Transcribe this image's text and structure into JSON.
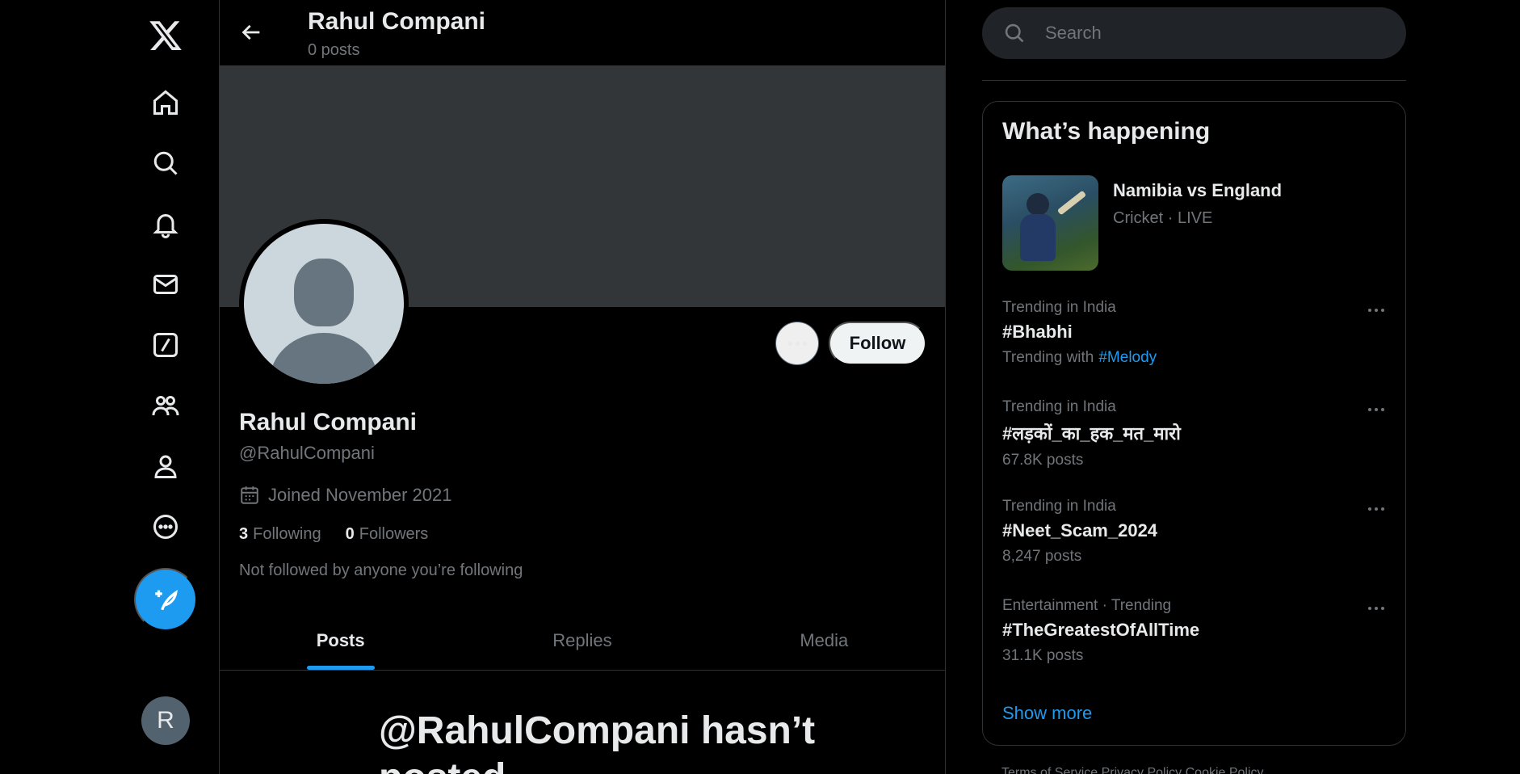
{
  "nav": {
    "items": [
      "home-icon",
      "explore-icon",
      "notifications-icon",
      "messages-icon",
      "grok-icon",
      "communities-icon",
      "profile-icon",
      "more-icon"
    ],
    "compose": "compose-post-icon",
    "account_initial": "R"
  },
  "header": {
    "name": "Rahul Compani",
    "post_count": "0 posts"
  },
  "profile": {
    "name": "Rahul Compani",
    "handle": "@RahulCompani",
    "joined": "Joined November 2021",
    "following_count": "3",
    "following_label": "Following",
    "followers_count": "0",
    "followers_label": "Followers",
    "not_followed_text": "Not followed by anyone you’re following",
    "follow_label": "Follow"
  },
  "tabs": [
    "Posts",
    "Replies",
    "Media"
  ],
  "empty": {
    "title": "@RahulCompani hasn’t posted"
  },
  "search": {
    "placeholder": "Search"
  },
  "trends": {
    "title": "What’s happening",
    "featured": {
      "title": "Namibia vs England",
      "subtitle": "Cricket · LIVE"
    },
    "items": [
      {
        "context": "Trending in India",
        "tag": "#Bhabhi",
        "meta": "Trending with",
        "link": "#Melody"
      },
      {
        "context": "Trending in India",
        "tag": "#लड़कों_का_हक_मत_मारो",
        "meta": "67.8K posts"
      },
      {
        "context": "Trending in India",
        "tag": "#Neet_Scam_2024",
        "meta": "8,247 posts"
      },
      {
        "context": "Entertainment · Trending",
        "tag": "#TheGreatestOfAllTime",
        "meta": "31.1K posts"
      }
    ],
    "show_more": "Show more"
  },
  "footer": {
    "text": "Terms of Service   Privacy Policy   Cookie Policy"
  },
  "colors": {
    "accent": "#1d9bf0",
    "background": "#000000",
    "banner": "#333639",
    "muted_text": "#71767b"
  }
}
